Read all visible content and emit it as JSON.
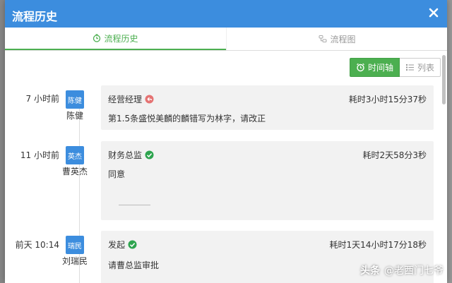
{
  "dialog": {
    "title": "流程历史"
  },
  "tabs": [
    {
      "label": "流程历史",
      "icon": "clock-icon",
      "active": true
    },
    {
      "label": "流程图",
      "icon": "flow-icon",
      "active": false
    }
  ],
  "view_toggle": {
    "timeline": "时间轴",
    "list": "列表"
  },
  "entries": [
    {
      "time": "7 小时前",
      "avatar": "陈健",
      "name": "陈健",
      "role": "经营经理",
      "status": "rejected",
      "duration": "耗时3小时15分37秒",
      "comment": "第1.5条盛悦美麟的麟错写为林字，请改正"
    },
    {
      "time": "11 小时前",
      "avatar": "英杰",
      "name": "曹英杰",
      "role": "财务总监",
      "status": "approved",
      "duration": "耗时2天58分3秒",
      "comment": "同意"
    },
    {
      "time": "前天 10:14",
      "avatar": "瑞民",
      "name": "刘瑞民",
      "role": "发起",
      "status": "approved",
      "duration": "耗时1天14小时17分18秒",
      "comment": "请曹总监审批"
    }
  ],
  "watermark": {
    "brand": "头条",
    "handle": "@老西门七爷"
  },
  "colors": {
    "header": "#3c8dde",
    "accent": "#4caf50",
    "reject": "#e57373"
  }
}
